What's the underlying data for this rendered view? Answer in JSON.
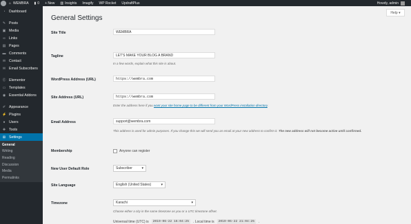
{
  "admin_bar": {
    "site_name": "WEMBRA",
    "comments_count": "0",
    "new_label": "+ New",
    "items": [
      "Insights",
      "Imagify",
      "WP Rocket",
      "UpdraftPlus"
    ],
    "greeting": "Howdy, admin"
  },
  "sidebar": {
    "items": [
      {
        "label": "Dashboard",
        "icon": "dashboard-icon"
      },
      {
        "label": "Posts",
        "icon": "pin-icon"
      },
      {
        "label": "Media",
        "icon": "media-icon"
      },
      {
        "label": "Links",
        "icon": "link-icon"
      },
      {
        "label": "Pages",
        "icon": "page-icon"
      },
      {
        "label": "Comments",
        "icon": "comment-icon"
      },
      {
        "label": "Contact",
        "icon": "mail-icon"
      },
      {
        "label": "Email Subscribers",
        "icon": "mail-icon"
      },
      {
        "label": "Elementor",
        "icon": "elementor-icon"
      },
      {
        "label": "Templates",
        "icon": "folder-icon"
      },
      {
        "label": "Essential Addons",
        "icon": "addons-icon"
      },
      {
        "label": "Appearance",
        "icon": "brush-icon"
      },
      {
        "label": "Plugins",
        "icon": "plugin-icon"
      },
      {
        "label": "Users",
        "icon": "user-icon"
      },
      {
        "label": "Tools",
        "icon": "wrench-icon"
      },
      {
        "label": "Settings",
        "icon": "settings-icon"
      }
    ],
    "submenu": [
      "General",
      "Writing",
      "Reading",
      "Discussion",
      "Media",
      "Permalinks"
    ]
  },
  "help_tab": {
    "label": "Help ▾"
  },
  "page": {
    "title": "General Settings",
    "fields": {
      "site_title": {
        "label": "Site Title",
        "value": "WEMBRA"
      },
      "tagline": {
        "label": "Tagline",
        "value": "LET'S MAKE YOUR BLOG A BRAND",
        "description": "In a few words, explain what this site is about."
      },
      "wp_address": {
        "label": "WordPress Address (URL)",
        "value": "https://wembra.com"
      },
      "site_address": {
        "label": "Site Address (URL)",
        "value": "https://wembra.com",
        "desc_before": "Enter the address here if you ",
        "desc_link": "want your site home page to be different from your WordPress installation directory",
        "desc_after": "."
      },
      "email": {
        "label": "Email Address",
        "value": "support@wembra.com",
        "desc_normal": "This address is used for admin purposes. If you change this we will send you an email at your new address to confirm it. ",
        "desc_bold1": "The new address will not become active",
        "desc_bold2": "until confirmed."
      },
      "membership": {
        "label": "Membership",
        "checkbox_label": "Anyone can register"
      },
      "default_role": {
        "label": "New User Default Role",
        "value": "Subscriber"
      },
      "language": {
        "label": "Site Language",
        "value": "English (United States)"
      },
      "timezone": {
        "label": "Timezone",
        "value": "Karachi",
        "description": "Choose either a city in the same timezone as you or a UTC timezone offset.",
        "utc_label": "Universal time (UTC) is",
        "utc_value": "2019-06-22 16:04:25",
        "local_label": ". Local time is",
        "local_value": "2019-06-22 21:04:25",
        "trailing": "."
      }
    }
  },
  "colors": {
    "sidebar_bg": "#23282d",
    "active_item": "#0073aa",
    "link": "#0073aa",
    "page_bg": "#f1f1f1"
  }
}
